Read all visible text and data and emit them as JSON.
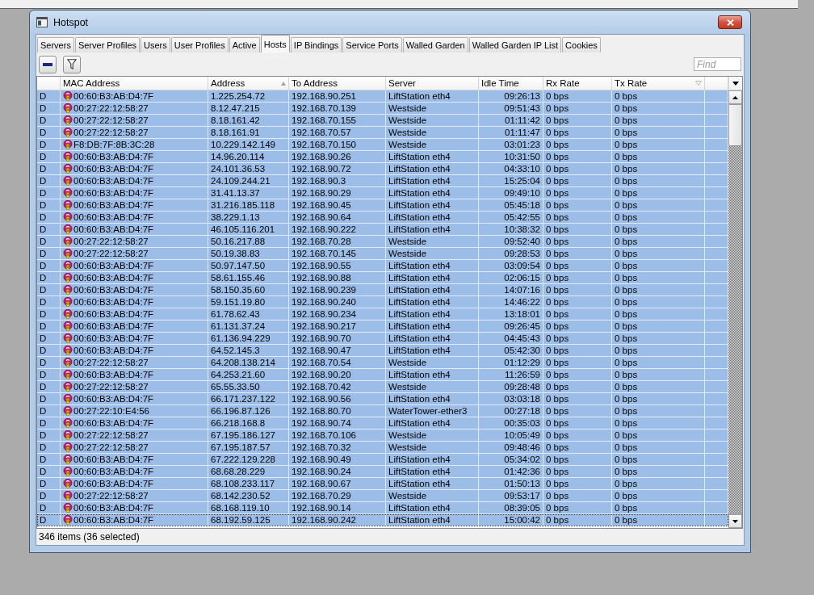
{
  "window": {
    "title": "Hotspot"
  },
  "tabs": [
    {
      "label": "Servers",
      "selected": false
    },
    {
      "label": "Server Profiles",
      "selected": false
    },
    {
      "label": "Users",
      "selected": false
    },
    {
      "label": "User Profiles",
      "selected": false
    },
    {
      "label": "Active",
      "selected": false
    },
    {
      "label": "Hosts",
      "selected": true
    },
    {
      "label": "IP Bindings",
      "selected": false
    },
    {
      "label": "Service Ports",
      "selected": false
    },
    {
      "label": "Walled Garden",
      "selected": false
    },
    {
      "label": "Walled Garden IP List",
      "selected": false
    },
    {
      "label": "Cookies",
      "selected": false
    }
  ],
  "toolbar": {
    "find": {
      "placeholder": "Find"
    }
  },
  "table": {
    "columns": [
      {
        "label": "MAC Address",
        "sort_up": false,
        "sort_down": false
      },
      {
        "label": "Address",
        "sort_up": true,
        "sort_down": false
      },
      {
        "label": "To Address",
        "sort_up": false,
        "sort_down": false
      },
      {
        "label": "Server",
        "sort_up": false,
        "sort_down": false
      },
      {
        "label": "Idle Time",
        "sort_up": false,
        "sort_down": false
      },
      {
        "label": "Rx Rate",
        "sort_up": false,
        "sort_down": false
      },
      {
        "label": "Tx Rate",
        "sort_up": false,
        "sort_down": true
      }
    ],
    "rows": [
      {
        "flag": "D",
        "cells": [
          "00:60:B3:AB:D4:7F",
          "1.225.254.72",
          "192.168.90.251",
          "LiftStation eth4",
          "09:26:13",
          "0 bps",
          "0 bps"
        ],
        "selected": true,
        "focused": false
      },
      {
        "flag": "D",
        "cells": [
          "00:27:22:12:58:27",
          "8.12.47.215",
          "192.168.70.139",
          "Westside",
          "09:51:43",
          "0 bps",
          "0 bps"
        ],
        "selected": true,
        "focused": false
      },
      {
        "flag": "D",
        "cells": [
          "00:27:22:12:58:27",
          "8.18.161.42",
          "192.168.70.155",
          "Westside",
          "01:11:42",
          "0 bps",
          "0 bps"
        ],
        "selected": true,
        "focused": false
      },
      {
        "flag": "D",
        "cells": [
          "00:27:22:12:58:27",
          "8.18.161.91",
          "192.168.70.57",
          "Westside",
          "01:11:47",
          "0 bps",
          "0 bps"
        ],
        "selected": true,
        "focused": false
      },
      {
        "flag": "D",
        "cells": [
          "F8:DB:7F:8B:3C:28",
          "10.229.142.149",
          "192.168.70.150",
          "Westside",
          "03:01:23",
          "0 bps",
          "0 bps"
        ],
        "selected": true,
        "focused": false
      },
      {
        "flag": "D",
        "cells": [
          "00:60:B3:AB:D4:7F",
          "14.96.20.114",
          "192.168.90.26",
          "LiftStation eth4",
          "10:31:50",
          "0 bps",
          "0 bps"
        ],
        "selected": true,
        "focused": false
      },
      {
        "flag": "D",
        "cells": [
          "00:60:B3:AB:D4:7F",
          "24.101.36.53",
          "192.168.90.72",
          "LiftStation eth4",
          "04:33:10",
          "0 bps",
          "0 bps"
        ],
        "selected": true,
        "focused": false
      },
      {
        "flag": "D",
        "cells": [
          "00:60:B3:AB:D4:7F",
          "24.109.244.21",
          "192.168.90.3",
          "LiftStation eth4",
          "15:25:04",
          "0 bps",
          "0 bps"
        ],
        "selected": true,
        "focused": false
      },
      {
        "flag": "D",
        "cells": [
          "00:60:B3:AB:D4:7F",
          "31.41.13.37",
          "192.168.90.29",
          "LiftStation eth4",
          "09:49:10",
          "0 bps",
          "0 bps"
        ],
        "selected": true,
        "focused": false
      },
      {
        "flag": "D",
        "cells": [
          "00:60:B3:AB:D4:7F",
          "31.216.185.118",
          "192.168.90.45",
          "LiftStation eth4",
          "05:45:18",
          "0 bps",
          "0 bps"
        ],
        "selected": true,
        "focused": false
      },
      {
        "flag": "D",
        "cells": [
          "00:60:B3:AB:D4:7F",
          "38.229.1.13",
          "192.168.90.64",
          "LiftStation eth4",
          "05:42:55",
          "0 bps",
          "0 bps"
        ],
        "selected": true,
        "focused": false
      },
      {
        "flag": "D",
        "cells": [
          "00:60:B3:AB:D4:7F",
          "46.105.116.201",
          "192.168.90.222",
          "LiftStation eth4",
          "10:38:32",
          "0 bps",
          "0 bps"
        ],
        "selected": true,
        "focused": false
      },
      {
        "flag": "D",
        "cells": [
          "00:27:22:12:58:27",
          "50.16.217.88",
          "192.168.70.28",
          "Westside",
          "09:52:40",
          "0 bps",
          "0 bps"
        ],
        "selected": true,
        "focused": false
      },
      {
        "flag": "D",
        "cells": [
          "00:27:22:12:58:27",
          "50.19.38.83",
          "192.168.70.145",
          "Westside",
          "09:28:53",
          "0 bps",
          "0 bps"
        ],
        "selected": true,
        "focused": false
      },
      {
        "flag": "D",
        "cells": [
          "00:60:B3:AB:D4:7F",
          "50.97.147.50",
          "192.168.90.55",
          "LiftStation eth4",
          "03:09:54",
          "0 bps",
          "0 bps"
        ],
        "selected": true,
        "focused": false
      },
      {
        "flag": "D",
        "cells": [
          "00:60:B3:AB:D4:7F",
          "58.61.155.46",
          "192.168.90.88",
          "LiftStation eth4",
          "02:06:15",
          "0 bps",
          "0 bps"
        ],
        "selected": true,
        "focused": false
      },
      {
        "flag": "D",
        "cells": [
          "00:60:B3:AB:D4:7F",
          "58.150.35.60",
          "192.168.90.239",
          "LiftStation eth4",
          "14:07:16",
          "0 bps",
          "0 bps"
        ],
        "selected": true,
        "focused": false
      },
      {
        "flag": "D",
        "cells": [
          "00:60:B3:AB:D4:7F",
          "59.151.19.80",
          "192.168.90.240",
          "LiftStation eth4",
          "14:46:22",
          "0 bps",
          "0 bps"
        ],
        "selected": true,
        "focused": false
      },
      {
        "flag": "D",
        "cells": [
          "00:60:B3:AB:D4:7F",
          "61.78.62.43",
          "192.168.90.234",
          "LiftStation eth4",
          "13:18:01",
          "0 bps",
          "0 bps"
        ],
        "selected": true,
        "focused": false
      },
      {
        "flag": "D",
        "cells": [
          "00:60:B3:AB:D4:7F",
          "61.131.37.24",
          "192.168.90.217",
          "LiftStation eth4",
          "09:26:45",
          "0 bps",
          "0 bps"
        ],
        "selected": true,
        "focused": false
      },
      {
        "flag": "D",
        "cells": [
          "00:60:B3:AB:D4:7F",
          "61.136.94.229",
          "192.168.90.70",
          "LiftStation eth4",
          "04:45:43",
          "0 bps",
          "0 bps"
        ],
        "selected": true,
        "focused": false
      },
      {
        "flag": "D",
        "cells": [
          "00:60:B3:AB:D4:7F",
          "64.52.145.3",
          "192.168.90.47",
          "LiftStation eth4",
          "05:42:30",
          "0 bps",
          "0 bps"
        ],
        "selected": true,
        "focused": false
      },
      {
        "flag": "D",
        "cells": [
          "00:27:22:12:58:27",
          "64.208.138.214",
          "192.168.70.54",
          "Westside",
          "01:12:29",
          "0 bps",
          "0 bps"
        ],
        "selected": true,
        "focused": false
      },
      {
        "flag": "D",
        "cells": [
          "00:60:B3:AB:D4:7F",
          "64.253.21.60",
          "192.168.90.20",
          "LiftStation eth4",
          "11:26:59",
          "0 bps",
          "0 bps"
        ],
        "selected": true,
        "focused": false
      },
      {
        "flag": "D",
        "cells": [
          "00:27:22:12:58:27",
          "65.55.33.50",
          "192.168.70.42",
          "Westside",
          "09:28:48",
          "0 bps",
          "0 bps"
        ],
        "selected": true,
        "focused": false
      },
      {
        "flag": "D",
        "cells": [
          "00:60:B3:AB:D4:7F",
          "66.171.237.122",
          "192.168.90.56",
          "LiftStation eth4",
          "03:03:18",
          "0 bps",
          "0 bps"
        ],
        "selected": true,
        "focused": false
      },
      {
        "flag": "D",
        "cells": [
          "00:27:22:10:E4:56",
          "66.196.87.126",
          "192.168.80.70",
          "WaterTower-ether3",
          "00:27:18",
          "0 bps",
          "0 bps"
        ],
        "selected": true,
        "focused": false
      },
      {
        "flag": "D",
        "cells": [
          "00:60:B3:AB:D4:7F",
          "66.218.168.8",
          "192.168.90.74",
          "LiftStation eth4",
          "00:35:03",
          "0 bps",
          "0 bps"
        ],
        "selected": true,
        "focused": false
      },
      {
        "flag": "D",
        "cells": [
          "00:27:22:12:58:27",
          "67.195.186.127",
          "192.168.70.106",
          "Westside",
          "10:05:49",
          "0 bps",
          "0 bps"
        ],
        "selected": true,
        "focused": false
      },
      {
        "flag": "D",
        "cells": [
          "00:27:22:12:58:27",
          "67.195.187.57",
          "192.168.70.32",
          "Westside",
          "09:48:46",
          "0 bps",
          "0 bps"
        ],
        "selected": true,
        "focused": false
      },
      {
        "flag": "D",
        "cells": [
          "00:60:B3:AB:D4:7F",
          "67.222.129.228",
          "192.168.90.49",
          "LiftStation eth4",
          "05:34:02",
          "0 bps",
          "0 bps"
        ],
        "selected": true,
        "focused": false
      },
      {
        "flag": "D",
        "cells": [
          "00:60:B3:AB:D4:7F",
          "68.68.28.229",
          "192.168.90.24",
          "LiftStation eth4",
          "01:42:36",
          "0 bps",
          "0 bps"
        ],
        "selected": true,
        "focused": false
      },
      {
        "flag": "D",
        "cells": [
          "00:60:B3:AB:D4:7F",
          "68.108.233.117",
          "192.168.90.67",
          "LiftStation eth4",
          "01:50:13",
          "0 bps",
          "0 bps"
        ],
        "selected": true,
        "focused": false
      },
      {
        "flag": "D",
        "cells": [
          "00:27:22:12:58:27",
          "68.142.230.52",
          "192.168.70.29",
          "Westside",
          "09:53:17",
          "0 bps",
          "0 bps"
        ],
        "selected": true,
        "focused": false
      },
      {
        "flag": "D",
        "cells": [
          "00:60:B3:AB:D4:7F",
          "68.168.119.10",
          "192.168.90.14",
          "LiftStation eth4",
          "08:39:05",
          "0 bps",
          "0 bps"
        ],
        "selected": true,
        "focused": false
      },
      {
        "flag": "D",
        "cells": [
          "00:60:B3:AB:D4:7F",
          "68.192.59.125",
          "192.168.90.242",
          "LiftStation eth4",
          "15:00:42",
          "0 bps",
          "0 bps"
        ],
        "selected": true,
        "focused": true
      }
    ]
  },
  "status_bar": {
    "text": "346 items (36 selected)"
  }
}
